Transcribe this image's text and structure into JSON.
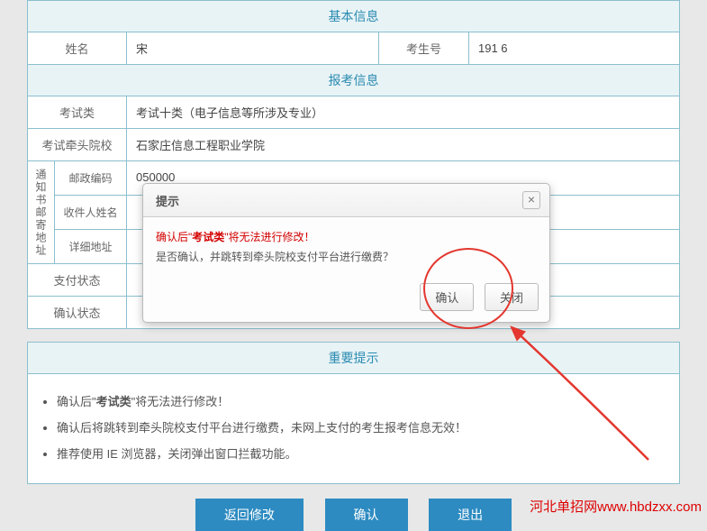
{
  "sections": {
    "basic_info_title": "基本信息",
    "exam_info_title": "报考信息",
    "tips_title": "重要提示"
  },
  "basic": {
    "name_label": "姓名",
    "name_value": "宋",
    "exam_no_label": "考生号",
    "exam_no_value": "191                    6"
  },
  "exam": {
    "type_label": "考试类",
    "type_value": "考试十类（电子信息等所涉及专业）",
    "school_label": "考试牵头院校",
    "school_value": "石家庄信息工程职业学院"
  },
  "mail": {
    "group_label": "通知书邮寄地址",
    "zip_label": "邮政编码",
    "zip_value": "050000",
    "recipient_label": "收件人姓名",
    "recipient_value": "",
    "address_label": "详细地址",
    "address_value": ""
  },
  "status": {
    "pay_label": "支付状态",
    "pay_value": "",
    "confirm_label": "确认状态",
    "confirm_value": ""
  },
  "tips": {
    "item1_prefix": "确认后\"",
    "item1_bold": "考试类",
    "item1_suffix": "\"将无法进行修改！",
    "item2": "确认后将跳转到牵头院校支付平台进行缴费，未网上支付的考生报考信息无效！",
    "item3": "推荐使用 IE 浏览器，关闭弹出窗口拦截功能。"
  },
  "buttons": {
    "back": "返回修改",
    "confirm": "确认",
    "exit": "退出"
  },
  "dialog": {
    "title": "提示",
    "warn_prefix": "确认后\"",
    "warn_bold": "考试类",
    "warn_suffix": "\"将无法进行修改！",
    "question": "是否确认，并跳转到牵头院校支付平台进行缴费？",
    "ok": "确认",
    "cancel": "关闭",
    "close_x": "×"
  },
  "watermark": "河北单招网www.hbdzxx.com"
}
